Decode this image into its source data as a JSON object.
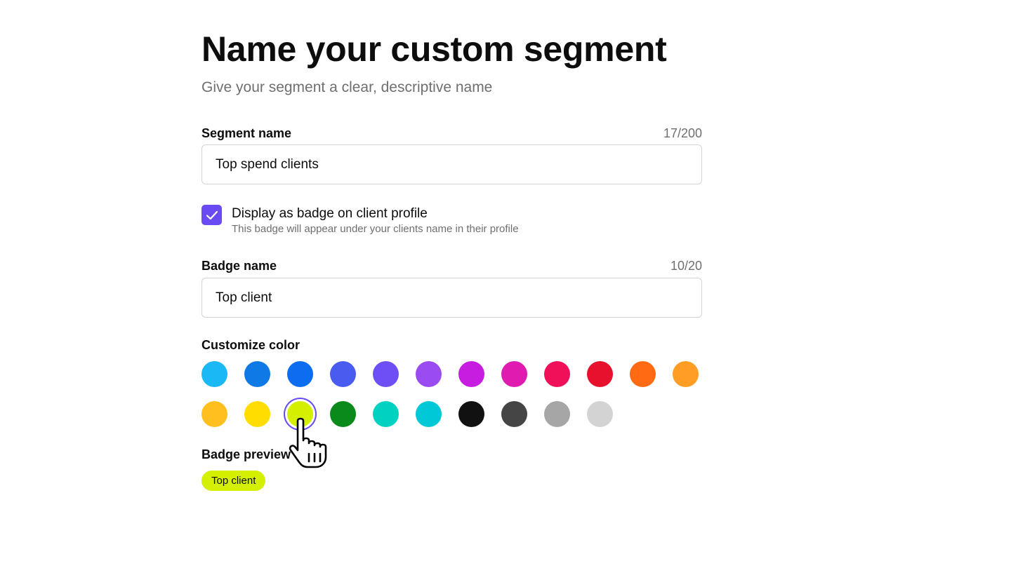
{
  "header": {
    "title": "Name your custom segment",
    "subtitle": "Give your segment a clear, descriptive name"
  },
  "segment_name": {
    "label": "Segment name",
    "counter": "17/200",
    "value": "Top spend clients"
  },
  "badge_option": {
    "checked": true,
    "label": "Display as badge on client profile",
    "help": "This badge will appear under your clients name in their profile"
  },
  "badge_name": {
    "label": "Badge name",
    "counter": "10/20",
    "value": "Top client"
  },
  "color_picker": {
    "label": "Customize color",
    "accent": "#6a4bf3",
    "selected_index": 14,
    "colors": [
      "#1ab8f5",
      "#0f7ae5",
      "#0d6df0",
      "#4a5cf0",
      "#6e4ff5",
      "#9a4cf2",
      "#c71de0",
      "#e01bb0",
      "#f0105a",
      "#e8112d",
      "#ff6a13",
      "#ff9d25",
      "#ffbf1f",
      "#ffdd00",
      "#d4f000",
      "#0a8a1a",
      "#00d1c1",
      "#00c8d6",
      "#111111",
      "#454545",
      "#a6a6a6",
      "#d3d3d3"
    ]
  },
  "badge_preview": {
    "label": "Badge preview",
    "text": "Top client",
    "color": "#d4f000"
  }
}
